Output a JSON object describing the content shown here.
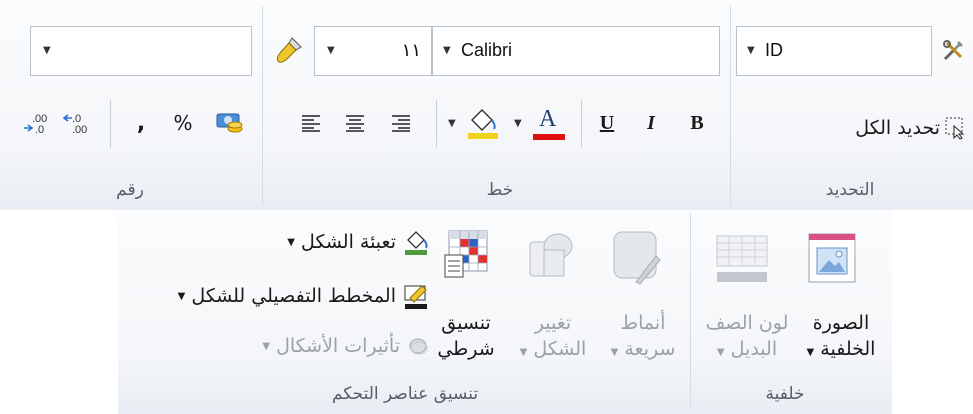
{
  "groups": {
    "number": {
      "label": "رقم"
    },
    "font": {
      "label": "خط"
    },
    "selection": {
      "label": "التحديد"
    },
    "control_format": {
      "label": "تنسيق عناصر التحكم"
    },
    "background": {
      "label": "خلفية"
    }
  },
  "number": {
    "format_value": "",
    "percent": "%",
    "comma": ","
  },
  "font": {
    "size": "١١",
    "name": "Calibri",
    "underline": "U",
    "italic": "I",
    "bold": "B",
    "font_color_letter": "A",
    "accent_red": "#e01010",
    "accent_yellow": "#f2d21b"
  },
  "selection": {
    "id_value": "ID",
    "select_all": "تحديد الكل"
  },
  "control_format": {
    "shape_fill": "تعبئة الشكل",
    "shape_outline": "المخطط التفصيلي للشكل",
    "shape_effects": "تأثيرات الأشكال",
    "conditional_format_line1": "تنسيق",
    "conditional_format_line2": "شرطي",
    "change_shape_line1": "تغيير",
    "change_shape_line2": "الشكل",
    "quick_styles_line1": "أنماط",
    "quick_styles_line2": "سريعة"
  },
  "background": {
    "alt_row_line1": "لون الصف",
    "alt_row_line2": "البديل",
    "bg_image_line1": "الصورة",
    "bg_image_line2": "الخلفية"
  }
}
